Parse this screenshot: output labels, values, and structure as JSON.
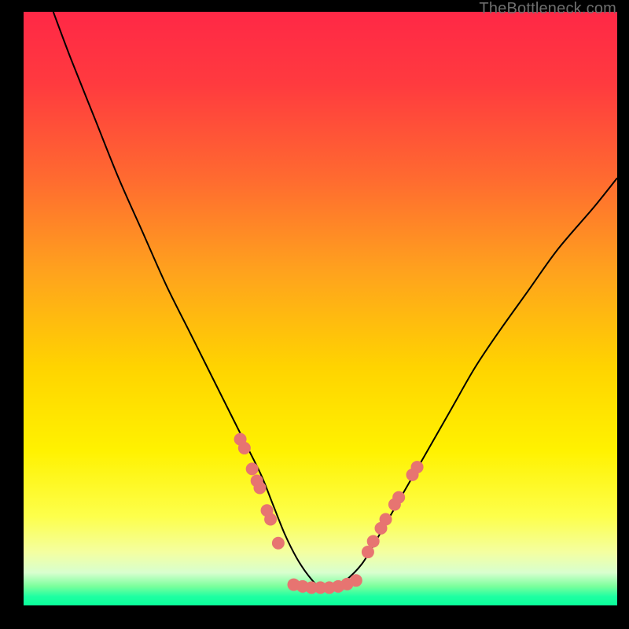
{
  "watermark": "TheBottleneck.com",
  "chart_data": {
    "type": "line",
    "title": "",
    "xlabel": "",
    "ylabel": "",
    "xlim": [
      0,
      100
    ],
    "ylim": [
      0,
      100
    ],
    "background_gradient": {
      "stops": [
        {
          "pos": 0.0,
          "color": "#ff2846"
        },
        {
          "pos": 0.12,
          "color": "#ff3a3f"
        },
        {
          "pos": 0.28,
          "color": "#ff6a30"
        },
        {
          "pos": 0.44,
          "color": "#ffa31d"
        },
        {
          "pos": 0.6,
          "color": "#ffd400"
        },
        {
          "pos": 0.74,
          "color": "#fff200"
        },
        {
          "pos": 0.85,
          "color": "#fdff4b"
        },
        {
          "pos": 0.91,
          "color": "#f4ffa0"
        },
        {
          "pos": 0.945,
          "color": "#d8ffcf"
        },
        {
          "pos": 0.968,
          "color": "#7aff9c"
        },
        {
          "pos": 0.985,
          "color": "#1effa2"
        },
        {
          "pos": 1.0,
          "color": "#0aff9a"
        }
      ]
    },
    "series": [
      {
        "name": "bottleneck-curve",
        "type": "line",
        "color": "#000000",
        "x": [
          5,
          8,
          12,
          16,
          20,
          24,
          28,
          31,
          34,
          37,
          40,
          42,
          44,
          46,
          48,
          50,
          52,
          54,
          57,
          60,
          64,
          68,
          72,
          76,
          80,
          85,
          90,
          96,
          100
        ],
        "y": [
          100,
          92,
          82,
          72,
          63,
          54,
          46,
          40,
          34,
          28,
          22,
          17,
          12,
          8,
          5,
          3,
          3,
          4,
          7,
          12,
          19,
          26,
          33,
          40,
          46,
          53,
          60,
          67,
          72
        ]
      },
      {
        "name": "sample-points-left",
        "type": "scatter",
        "color": "#e77471",
        "radius": 8,
        "x": [
          36.5,
          37.2,
          38.5,
          39.3,
          39.8,
          41.0,
          41.6,
          42.9
        ],
        "y": [
          28.0,
          26.5,
          23.0,
          21.0,
          19.8,
          16.0,
          14.5,
          10.5
        ]
      },
      {
        "name": "sample-points-right",
        "type": "scatter",
        "color": "#e77471",
        "radius": 8,
        "x": [
          58.0,
          58.9,
          60.2,
          61.0,
          62.5,
          63.2,
          65.5,
          66.3
        ],
        "y": [
          9.0,
          10.8,
          13.0,
          14.5,
          17.0,
          18.2,
          22.0,
          23.3
        ]
      },
      {
        "name": "sample-points-bottom",
        "type": "scatter",
        "color": "#e77471",
        "radius": 8,
        "x": [
          45.5,
          47.0,
          48.5,
          50.0,
          51.5,
          53.0,
          54.5,
          56.0
        ],
        "y": [
          3.5,
          3.2,
          3.0,
          3.0,
          3.0,
          3.2,
          3.6,
          4.2
        ]
      }
    ]
  }
}
